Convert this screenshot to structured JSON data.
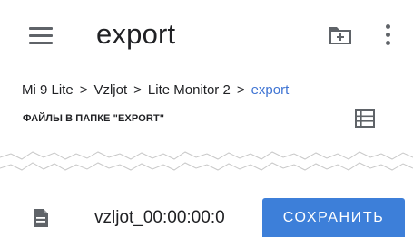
{
  "toolbar": {
    "title": "export",
    "menu_icon": "menu-icon",
    "new_folder_icon": "create-new-folder-icon",
    "more_icon": "more-vert-icon"
  },
  "breadcrumb": {
    "items": [
      "Mi 9 Lite",
      "Vzljot",
      "Lite Monitor 2"
    ],
    "separator": ">",
    "current": "export"
  },
  "section": {
    "title": "ФАЙЛЫ В ПАПКЕ \"EXPORT\"",
    "view_icon": "view-list-icon"
  },
  "file_row": {
    "icon": "file-icon",
    "filename_value": "vzljot_00:00:00:0",
    "save_label": "СОХРАНИТЬ"
  },
  "colors": {
    "accent": "#3d7fd9",
    "link": "#3f74d3",
    "icon": "#5f6368",
    "text": "#202124"
  }
}
